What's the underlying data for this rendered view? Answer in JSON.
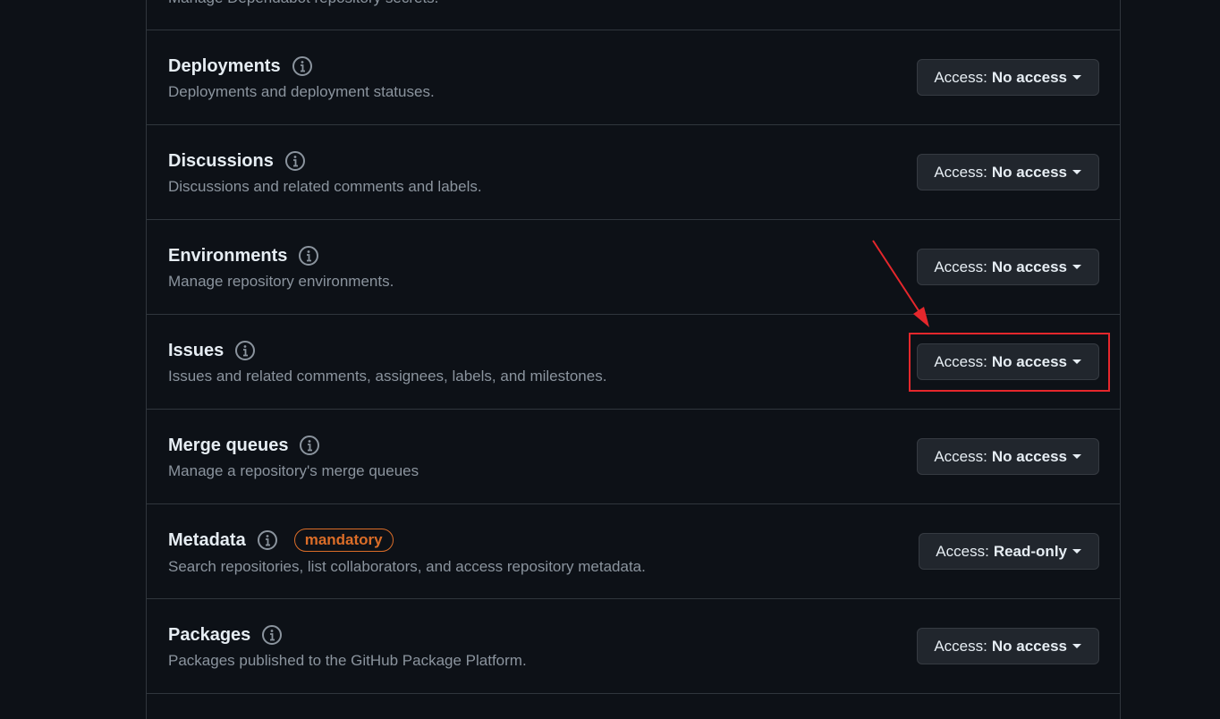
{
  "top_partial": {
    "desc": "Manage Dependabot repository secrets."
  },
  "permissions": [
    {
      "title": "Deployments",
      "desc": "Deployments and deployment statuses.",
      "access_label": "Access:",
      "access_value": "No access"
    },
    {
      "title": "Discussions",
      "desc": "Discussions and related comments and labels.",
      "access_label": "Access:",
      "access_value": "No access"
    },
    {
      "title": "Environments",
      "desc": "Manage repository environments.",
      "access_label": "Access:",
      "access_value": "No access"
    },
    {
      "title": "Issues",
      "desc": "Issues and related comments, assignees, labels, and milestones.",
      "access_label": "Access:",
      "access_value": "No access"
    },
    {
      "title": "Merge queues",
      "desc": "Manage a repository's merge queues",
      "access_label": "Access:",
      "access_value": "No access"
    },
    {
      "title": "Metadata",
      "badge": "mandatory",
      "desc": "Search repositories, list collaborators, and access repository metadata.",
      "access_label": "Access:",
      "access_value": "Read-only"
    },
    {
      "title": "Packages",
      "desc": "Packages published to the GitHub Package Platform.",
      "access_label": "Access:",
      "access_value": "No access"
    }
  ],
  "icons": {
    "info": "info-icon",
    "caret": "triangle-down-icon"
  },
  "colors": {
    "background": "#0d1117",
    "border": "#30363d",
    "button_bg": "#21262d",
    "text_primary": "#e6edf3",
    "text_muted": "#8b949e",
    "badge_orange": "#db6d28",
    "annotation_red": "#e5272c"
  }
}
